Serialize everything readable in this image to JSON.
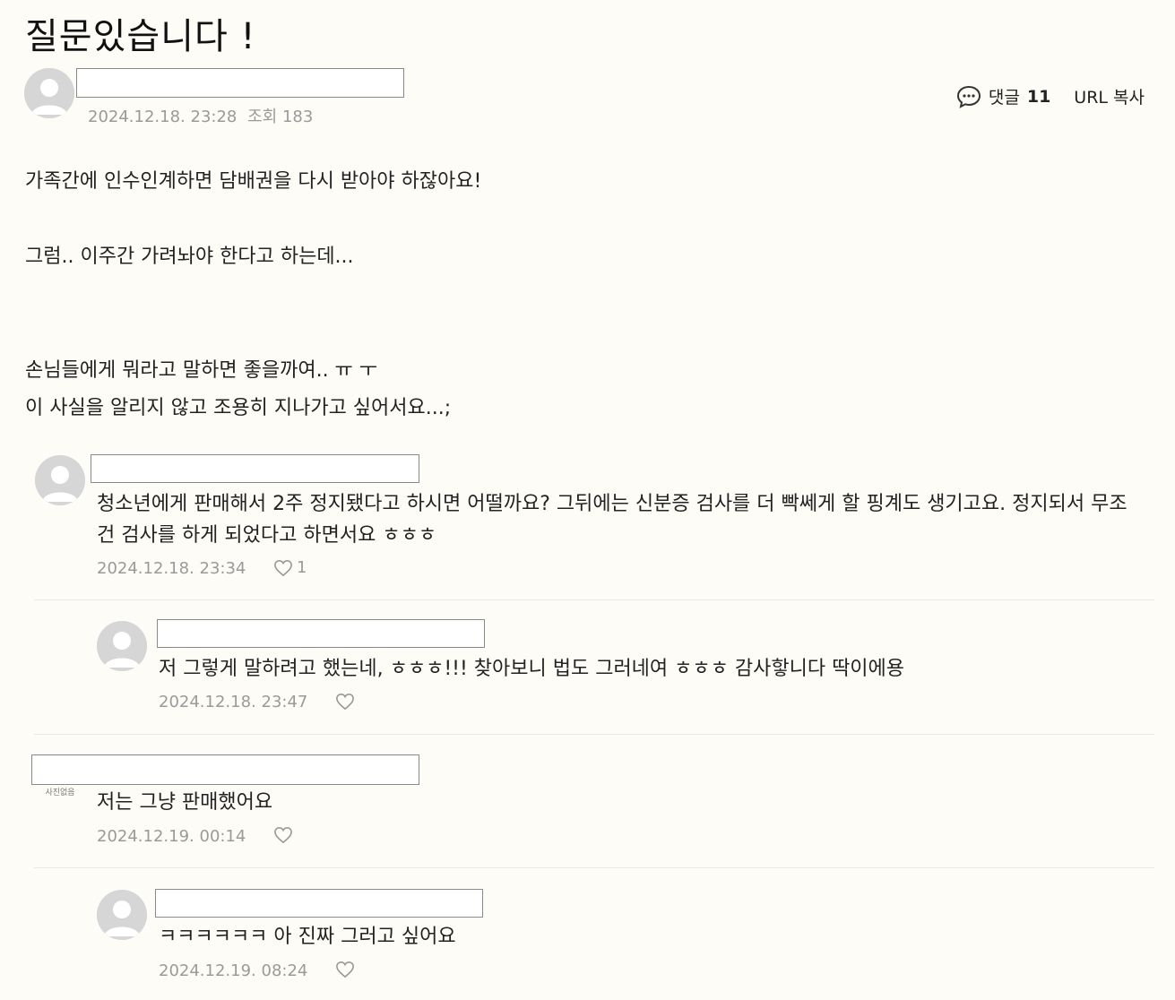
{
  "post": {
    "title": "질문있습니다 !",
    "date": "2024.12.18. 23:28",
    "views_label": "조회 183",
    "comment_label": "댓글",
    "comment_count": "11",
    "url_copy": "URL 복사",
    "lines": [
      "가족간에 인수인계하면 담배권을 다시 받아야 하잖아요!",
      "그럼.. 이주간 가려놔야 한다고 하는데...",
      "손님들에게 뭐라고 말하면 좋을까여.. ㅠ ㅜ",
      "이 사실을 알리지 않고 조용히 지나가고 싶어서요...;"
    ]
  },
  "comments": [
    {
      "text": "청소년에게 판매해서 2주 정지됐다고 하시면 어떨까요? 그뒤에는 신분증 검사를 더 빡쎄게 할 핑계도 생기고요. 정지되서 무조건 검사를 하게 되었다고 하면서요 ㅎㅎㅎ",
      "date": "2024.12.18. 23:34",
      "likes": "1"
    },
    {
      "text": "저 그렇게 말하려고 했는네, ㅎㅎㅎ!!! 찾아보니 법도 그러네여 ㅎㅎㅎ 감사핳니다 딱이에용",
      "date": "2024.12.18. 23:47",
      "likes": ""
    },
    {
      "text": "저는 그냥 판매했어요",
      "date": "2024.12.19. 00:14",
      "likes": "",
      "avatar_text": "사진없음"
    },
    {
      "text": "ㅋㅋㅋㅋㅋㅋ 아 진짜 그러고 싶어요",
      "date": "2024.12.19. 08:24",
      "likes": ""
    }
  ],
  "icons": {
    "comment": "speech-bubble-icon",
    "like": "heart-outline-icon",
    "avatar": "default-user-avatar"
  },
  "colors": {
    "background": "#fdfcf7",
    "meta_text": "#9a9a9a",
    "divider": "#e8e8e4"
  }
}
